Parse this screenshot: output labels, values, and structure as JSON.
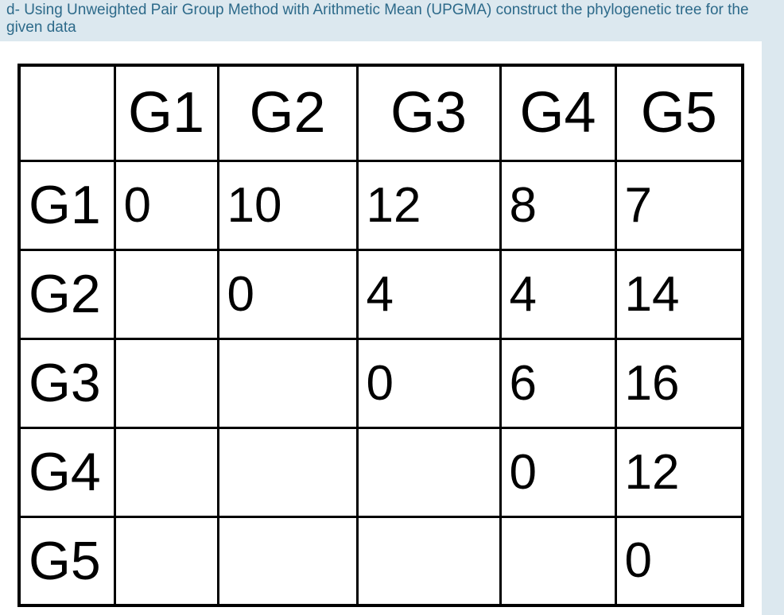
{
  "question": {
    "prefix": "d-",
    "text": "Using Unweighted Pair Group Method with Arithmetic Mean (UPGMA) construct the phylogenetic tree for the given data"
  },
  "matrix": {
    "labels": [
      "G1",
      "G2",
      "G3",
      "G4",
      "G5"
    ],
    "rows": [
      {
        "label": "G1",
        "cells": [
          "0",
          "10",
          "12",
          "8",
          "7"
        ]
      },
      {
        "label": "G2",
        "cells": [
          "",
          "0",
          "4",
          "4",
          "14"
        ]
      },
      {
        "label": "G3",
        "cells": [
          "",
          "",
          "0",
          "6",
          "16"
        ]
      },
      {
        "label": "G4",
        "cells": [
          "",
          "",
          "",
          "0",
          "12"
        ]
      },
      {
        "label": "G5",
        "cells": [
          "",
          "",
          "",
          "",
          "0"
        ]
      }
    ]
  },
  "chart_data": {
    "type": "table",
    "title": "UPGMA distance matrix",
    "row_labels": [
      "G1",
      "G2",
      "G3",
      "G4",
      "G5"
    ],
    "col_labels": [
      "G1",
      "G2",
      "G3",
      "G4",
      "G5"
    ],
    "values": [
      [
        0,
        10,
        12,
        8,
        7
      ],
      [
        null,
        0,
        4,
        4,
        14
      ],
      [
        null,
        null,
        0,
        6,
        16
      ],
      [
        null,
        null,
        null,
        0,
        12
      ],
      [
        null,
        null,
        null,
        null,
        0
      ]
    ]
  }
}
